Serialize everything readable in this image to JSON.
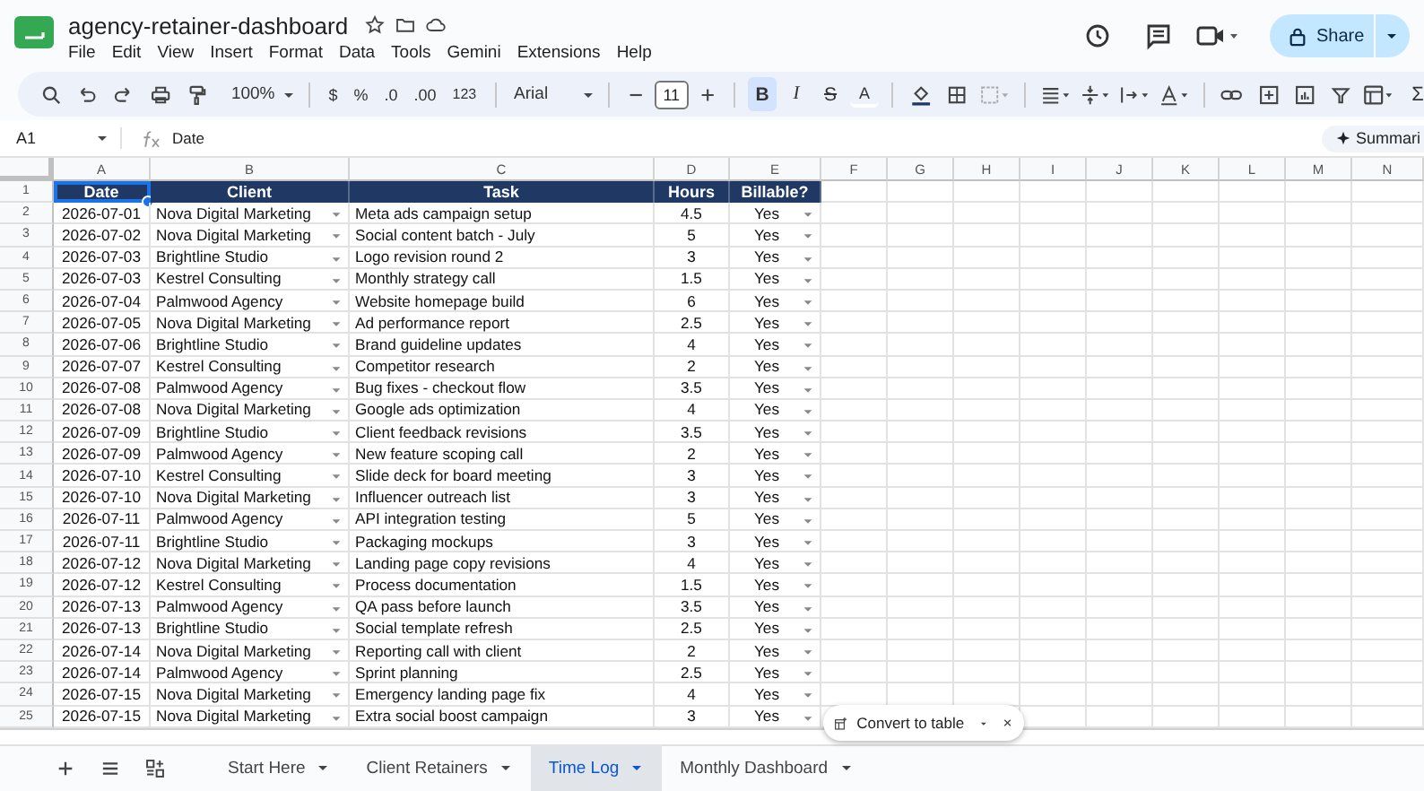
{
  "document": {
    "title": "agency-retainer-dashboard"
  },
  "menu": [
    "File",
    "Edit",
    "View",
    "Insert",
    "Format",
    "Data",
    "Tools",
    "Gemini",
    "Extensions",
    "Help"
  ],
  "share_button": "Share",
  "toolbar": {
    "zoom": "100%",
    "currency": "$",
    "percent": "%",
    "decrease_decimals": ".0",
    "increase_decimals": ".00",
    "number_format": "123",
    "font": "Arial",
    "font_size": "11",
    "format_buttons": [
      {
        "label": "B",
        "selected": true
      },
      {
        "label": "I",
        "selected": false
      },
      {
        "label": "S",
        "selected": false
      },
      {
        "label": "A",
        "selected": false
      }
    ],
    "sum": "Σ"
  },
  "formula_bar": {
    "cell_ref": "A1",
    "value": "Date",
    "summarize": "Summari"
  },
  "column_letters": [
    "A",
    "B",
    "C",
    "D",
    "E",
    "F",
    "G",
    "H",
    "I",
    "J",
    "K",
    "L",
    "M",
    "N"
  ],
  "row_numbers": [
    "1",
    "2",
    "3",
    "4",
    "5",
    "6",
    "7",
    "8",
    "9",
    "10",
    "11",
    "12",
    "13",
    "14",
    "15",
    "16",
    "17",
    "18",
    "19",
    "20",
    "21",
    "22",
    "23",
    "24",
    "25"
  ],
  "header": [
    {
      "text": "Date",
      "selected": true
    },
    {
      "text": "Client",
      "selected": false
    },
    {
      "text": "Task",
      "selected": false
    },
    {
      "text": "Hours",
      "selected": false
    },
    {
      "text": "Billable?",
      "selected": false
    }
  ],
  "rows": [
    {
      "date": "2026-07-01",
      "client": "Nova Digital Marketing",
      "task": "Meta ads campaign setup",
      "hours": "4.5",
      "billable": "Yes"
    },
    {
      "date": "2026-07-02",
      "client": "Nova Digital Marketing",
      "task": "Social content batch - July",
      "hours": "5",
      "billable": "Yes"
    },
    {
      "date": "2026-07-03",
      "client": "Brightline Studio",
      "task": "Logo revision round 2",
      "hours": "3",
      "billable": "Yes"
    },
    {
      "date": "2026-07-03",
      "client": "Kestrel Consulting",
      "task": "Monthly strategy call",
      "hours": "1.5",
      "billable": "Yes"
    },
    {
      "date": "2026-07-04",
      "client": "Palmwood Agency",
      "task": "Website homepage build",
      "hours": "6",
      "billable": "Yes"
    },
    {
      "date": "2026-07-05",
      "client": "Nova Digital Marketing",
      "task": "Ad performance report",
      "hours": "2.5",
      "billable": "Yes"
    },
    {
      "date": "2026-07-06",
      "client": "Brightline Studio",
      "task": "Brand guideline updates",
      "hours": "4",
      "billable": "Yes"
    },
    {
      "date": "2026-07-07",
      "client": "Kestrel Consulting",
      "task": "Competitor research",
      "hours": "2",
      "billable": "Yes"
    },
    {
      "date": "2026-07-08",
      "client": "Palmwood Agency",
      "task": "Bug fixes - checkout flow",
      "hours": "3.5",
      "billable": "Yes"
    },
    {
      "date": "2026-07-08",
      "client": "Nova Digital Marketing",
      "task": "Google ads optimization",
      "hours": "4",
      "billable": "Yes"
    },
    {
      "date": "2026-07-09",
      "client": "Brightline Studio",
      "task": "Client feedback revisions",
      "hours": "3.5",
      "billable": "Yes"
    },
    {
      "date": "2026-07-09",
      "client": "Palmwood Agency",
      "task": "New feature scoping call",
      "hours": "2",
      "billable": "Yes"
    },
    {
      "date": "2026-07-10",
      "client": "Kestrel Consulting",
      "task": "Slide deck for board meeting",
      "hours": "3",
      "billable": "Yes"
    },
    {
      "date": "2026-07-10",
      "client": "Nova Digital Marketing",
      "task": "Influencer outreach list",
      "hours": "3",
      "billable": "Yes"
    },
    {
      "date": "2026-07-11",
      "client": "Palmwood Agency",
      "task": "API integration testing",
      "hours": "5",
      "billable": "Yes"
    },
    {
      "date": "2026-07-11",
      "client": "Brightline Studio",
      "task": "Packaging mockups",
      "hours": "3",
      "billable": "Yes"
    },
    {
      "date": "2026-07-12",
      "client": "Nova Digital Marketing",
      "task": "Landing page copy revisions",
      "hours": "4",
      "billable": "Yes"
    },
    {
      "date": "2026-07-12",
      "client": "Kestrel Consulting",
      "task": "Process documentation",
      "hours": "1.5",
      "billable": "Yes"
    },
    {
      "date": "2026-07-13",
      "client": "Palmwood Agency",
      "task": "QA pass before launch",
      "hours": "3.5",
      "billable": "Yes"
    },
    {
      "date": "2026-07-13",
      "client": "Brightline Studio",
      "task": "Social template refresh",
      "hours": "2.5",
      "billable": "Yes"
    },
    {
      "date": "2026-07-14",
      "client": "Nova Digital Marketing",
      "task": "Reporting call with client",
      "hours": "2",
      "billable": "Yes"
    },
    {
      "date": "2026-07-14",
      "client": "Palmwood Agency",
      "task": "Sprint planning",
      "hours": "2.5",
      "billable": "Yes"
    },
    {
      "date": "2026-07-15",
      "client": "Nova Digital Marketing",
      "task": "Emergency landing page fix",
      "hours": "4",
      "billable": "Yes"
    },
    {
      "date": "2026-07-15",
      "client": "Nova Digital Marketing",
      "task": "Extra social boost campaign",
      "hours": "3",
      "billable": "Yes"
    }
  ],
  "popup": {
    "label": "Convert to table"
  },
  "sheet_tabs": [
    {
      "label": "Start Here",
      "selected": false
    },
    {
      "label": "Client Retainers",
      "selected": false
    },
    {
      "label": "Time Log",
      "selected": true
    },
    {
      "label": "Monthly Dashboard",
      "selected": false
    }
  ]
}
